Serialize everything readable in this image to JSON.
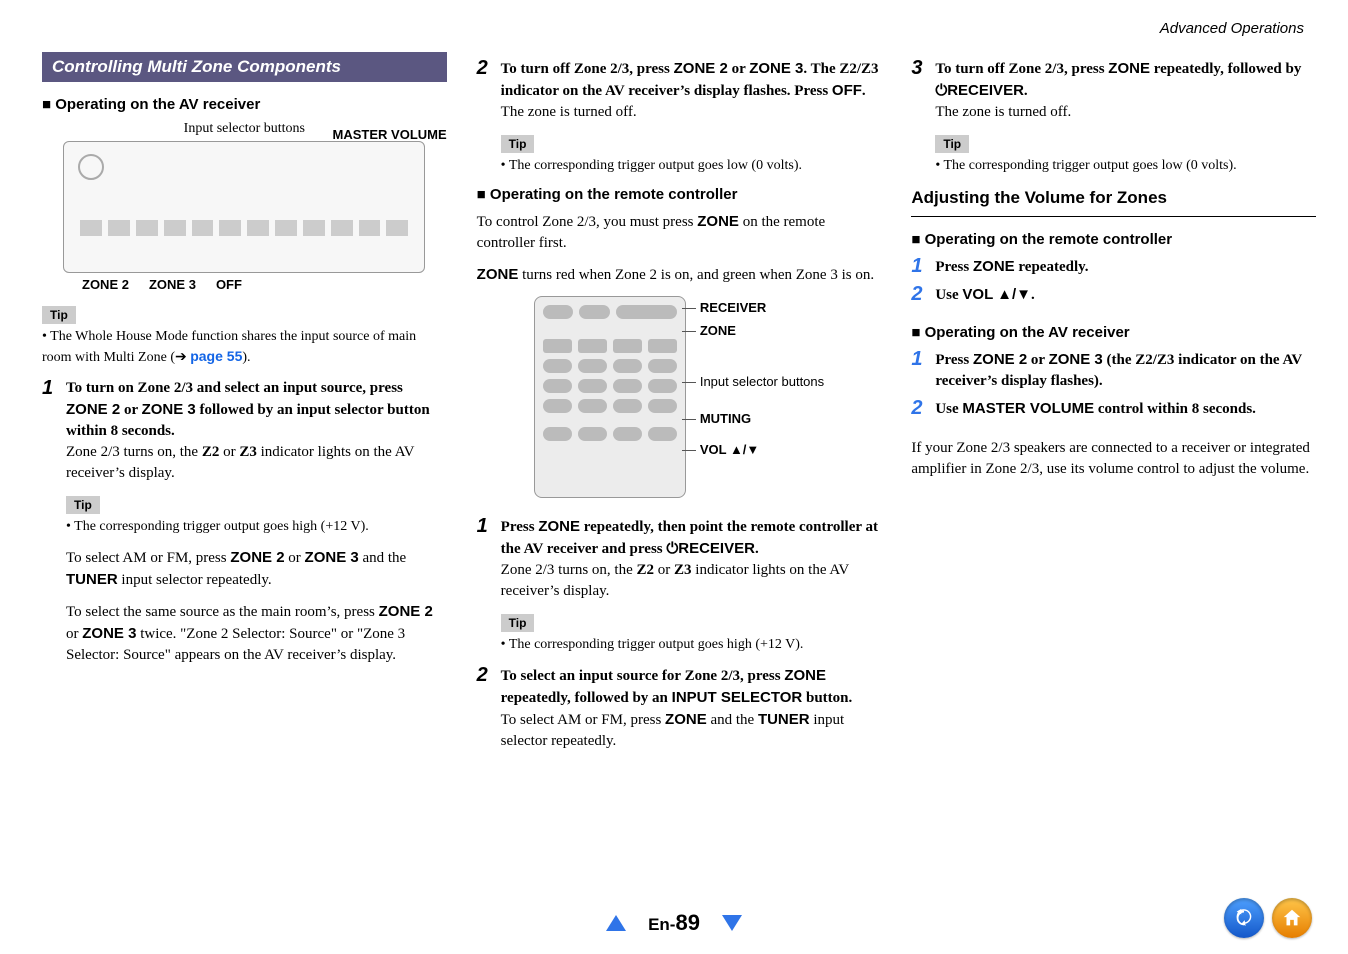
{
  "header": {
    "section": "Advanced Operations"
  },
  "col1": {
    "sectionTitle": "Controlling Multi Zone Components",
    "h1": "■ Operating on the AV receiver",
    "diagram": {
      "caption": "Input selector buttons",
      "rightLabel": "MASTER VOLUME",
      "bottomLabels": [
        "ZONE 2",
        "ZONE 3",
        "OFF"
      ]
    },
    "tip1Label": "Tip",
    "tip1Text": "• The Whole House Mode function shares the input source of main room with Multi Zone (➔ ",
    "tip1Link": "page 55",
    "tip1TextAfter": ").",
    "step1Num": "1",
    "step1a": "To turn on Zone 2/3 and select an input source, press ",
    "step1b": "ZONE 2",
    "step1c": " or ",
    "step1d": "ZONE 3",
    "step1e": " followed by an input selector button within 8 seconds.",
    "step1f": "Zone 2/3 turns on, the ",
    "step1g": "Z2",
    "step1h": " or ",
    "step1i": "Z3",
    "step1j": " indicator lights on the AV receiver’s display.",
    "tip2Label": "Tip",
    "tip2Text": "• The corresponding trigger output goes high (+12 V).",
    "para1a": "To select AM or FM, press ",
    "para1b": "ZONE 2",
    "para1c": " or ",
    "para1d": "ZONE 3",
    "para1e": " and the ",
    "para1f": "TUNER",
    "para1g": " input selector repeatedly.",
    "para2a": "To select the same source as the main room’s, press ",
    "para2b": "ZONE 2",
    "para2c": " or ",
    "para2d": "ZONE 3",
    "para2e": " twice. \"",
    "para2f": "Zone 2 Selector: Source",
    "para2g": "\" or \"",
    "para2h": "Zone 3 Selector: Source",
    "para2i": "\" appears on the AV receiver’s display."
  },
  "col2": {
    "step2Num": "2",
    "step2a": "To turn off Zone 2/3, press ",
    "step2b": "ZONE 2",
    "step2c": " or ",
    "step2d": "ZONE 3",
    "step2e": ". The Z2/Z3 indicator on the AV receiver’s display flashes. Press ",
    "step2f": "OFF",
    "step2g": ".",
    "step2h": "The zone is turned off.",
    "tip1Label": "Tip",
    "tip1Text": "• The corresponding trigger output goes low (0 volts).",
    "h2": "■ Operating on the remote controller",
    "intro1a": "To control Zone 2/3, you must press ",
    "intro1b": "ZONE",
    "intro1c": " on the remote controller first.",
    "intro2a": "ZONE",
    "intro2b": " turns red when Zone 2 is on, and green when Zone 3 is on.",
    "remoteLabels": [
      "RECEIVER",
      "ZONE",
      "Input selector buttons",
      "MUTING",
      "VOL ▲/▼"
    ],
    "rstep1Num": "1",
    "rstep1a": "Press ",
    "rstep1b": "ZONE",
    "rstep1c": " repeatedly, then point the remote controller at the AV receiver and press ",
    "rstep1d": "RECEIVER",
    "rstep1e": ".",
    "rstep1f": "Zone 2/3 turns on, the ",
    "rstep1g": "Z2",
    "rstep1h": " or ",
    "rstep1i": "Z3",
    "rstep1j": " indicator lights on the AV receiver’s display.",
    "tip2Label": "Tip",
    "tip2Text": "• The corresponding trigger output goes high (+12 V).",
    "rstep2Num": "2",
    "rstep2a": "To select an input source for Zone 2/3, press ",
    "rstep2b": "ZONE",
    "rstep2c": " repeatedly, followed by an ",
    "rstep2d": "INPUT SELECTOR",
    "rstep2e": " button.",
    "rstep2f": "To select AM or FM, press ",
    "rstep2g": "ZONE",
    "rstep2h": " and the ",
    "rstep2i": "TUNER",
    "rstep2j": " input selector repeatedly."
  },
  "col3": {
    "step3Num": "3",
    "step3a": "To turn off Zone 2/3, press ",
    "step3b": "ZONE",
    "step3c": " repeatedly, followed by ",
    "step3d": "RECEIVER",
    "step3e": ".",
    "step3f": "The zone is turned off.",
    "tip1Label": "Tip",
    "tip1Text": "• The corresponding trigger output goes low (0 volts).",
    "h1": "Adjusting the Volume for Zones",
    "h2": "■ Operating on the remote controller",
    "s1Num": "1",
    "s1a": "Press ",
    "s1b": "ZONE",
    "s1c": " repeatedly.",
    "s2Num": "2",
    "s2a": "Use ",
    "s2b": "VOL ▲/▼",
    "s2c": ".",
    "h3": "■ Operating on the AV receiver",
    "a1Num": "1",
    "a1a": "Press ",
    "a1b": "ZONE 2",
    "a1c": " or ",
    "a1d": "ZONE 3",
    "a1e": " (the Z2/Z3 indicator on the AV receiver’s display flashes).",
    "a2Num": "2",
    "a2a": "Use ",
    "a2b": "MASTER VOLUME",
    "a2c": " control within 8 seconds.",
    "note": "If your Zone 2/3 speakers are connected to a receiver or integrated amplifier in Zone 2/3, use its volume control to adjust the volume."
  },
  "footer": {
    "prefix": "En-",
    "page": "89"
  }
}
